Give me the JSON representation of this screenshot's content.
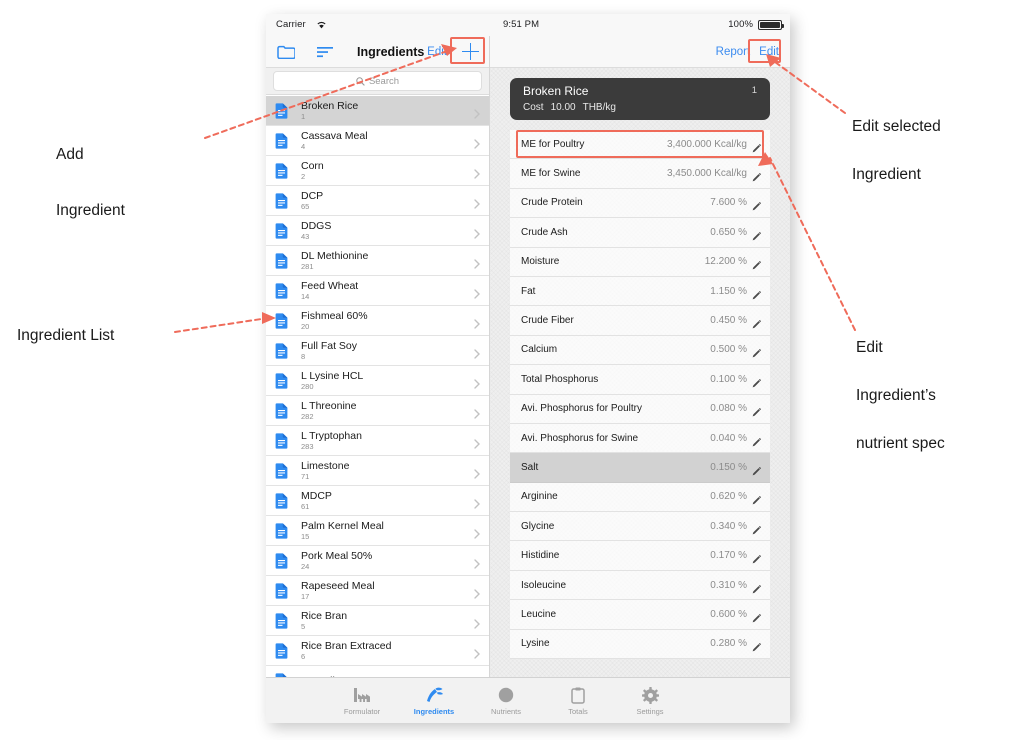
{
  "status_left": {
    "carrier": "Carrier",
    "wifi_icon": "wifi-icon"
  },
  "status_right": {
    "time": "9:51 PM",
    "battery_percent": "100%",
    "battery_icon": "battery-full-icon"
  },
  "master": {
    "title": "Ingredients",
    "edit_label": "Edit",
    "folder_icon": "folder-icon",
    "sort_icon": "sort-icon",
    "add_icon": "plus-icon",
    "search_placeholder": "Search",
    "search_icon": "search-icon",
    "items": [
      {
        "name": "Broken Rice",
        "num": "1",
        "selected": true
      },
      {
        "name": "Cassava Meal",
        "num": "4",
        "selected": false
      },
      {
        "name": "Corn",
        "num": "2",
        "selected": false
      },
      {
        "name": "DCP",
        "num": "65",
        "selected": false
      },
      {
        "name": "DDGS",
        "num": "43",
        "selected": false
      },
      {
        "name": "DL Methionine",
        "num": "281",
        "selected": false
      },
      {
        "name": "Feed Wheat",
        "num": "14",
        "selected": false
      },
      {
        "name": "Fishmeal 60%",
        "num": "20",
        "selected": false
      },
      {
        "name": "Full Fat Soy",
        "num": "8",
        "selected": false
      },
      {
        "name": "L Lysine HCL",
        "num": "280",
        "selected": false
      },
      {
        "name": "L Threonine",
        "num": "282",
        "selected": false
      },
      {
        "name": "L Tryptophan",
        "num": "283",
        "selected": false
      },
      {
        "name": "Limestone",
        "num": "71",
        "selected": false
      },
      {
        "name": "MDCP",
        "num": "61",
        "selected": false
      },
      {
        "name": "Palm Kernel Meal",
        "num": "15",
        "selected": false
      },
      {
        "name": "Pork Meal 50%",
        "num": "24",
        "selected": false
      },
      {
        "name": "Rapeseed Meal",
        "num": "17",
        "selected": false
      },
      {
        "name": "Rice Bran",
        "num": "5",
        "selected": false
      },
      {
        "name": "Rice Bran Extraced",
        "num": "6",
        "selected": false
      },
      {
        "name": "Soy Oil",
        "num": "",
        "selected": false
      }
    ]
  },
  "detail": {
    "report_label": "Report",
    "edit_label": "Edit",
    "card": {
      "title": "Broken Rice",
      "count": "1",
      "cost_label": "Cost",
      "cost_value": "10.00",
      "cost_unit": "THB/kg"
    },
    "edit_icon": "pencil-icon",
    "nutrients": [
      {
        "label": "ME for Poultry",
        "value": "3,400.000 Kcal/kg",
        "highlight": false
      },
      {
        "label": "ME for Swine",
        "value": "3,450.000 Kcal/kg",
        "highlight": false
      },
      {
        "label": "Crude Protein",
        "value": "7.600 %",
        "highlight": false
      },
      {
        "label": "Crude Ash",
        "value": "0.650 %",
        "highlight": false
      },
      {
        "label": "Moisture",
        "value": "12.200 %",
        "highlight": false
      },
      {
        "label": "Fat",
        "value": "1.150 %",
        "highlight": false
      },
      {
        "label": "Crude Fiber",
        "value": "0.450 %",
        "highlight": false
      },
      {
        "label": "Calcium",
        "value": "0.500 %",
        "highlight": false
      },
      {
        "label": "Total Phosphorus",
        "value": "0.100 %",
        "highlight": false
      },
      {
        "label": "Avi. Phosphorus for Poultry",
        "value": "0.080 %",
        "highlight": false
      },
      {
        "label": "Avi. Phosphorus for Swine",
        "value": "0.040 %",
        "highlight": false
      },
      {
        "label": "Salt",
        "value": "0.150 %",
        "highlight": true
      },
      {
        "label": "Arginine",
        "value": "0.620 %",
        "highlight": false
      },
      {
        "label": "Glycine",
        "value": "0.340 %",
        "highlight": false
      },
      {
        "label": "Histidine",
        "value": "0.170 %",
        "highlight": false
      },
      {
        "label": "Isoleucine",
        "value": "0.310 %",
        "highlight": false
      },
      {
        "label": "Leucine",
        "value": "0.600 %",
        "highlight": false
      },
      {
        "label": "Lysine",
        "value": "0.280 %",
        "highlight": false
      }
    ]
  },
  "tabbar": {
    "tabs": [
      {
        "label": "Formulator",
        "icon": "factory-icon",
        "active": false
      },
      {
        "label": "Ingredients",
        "icon": "ingredients-icon",
        "active": true
      },
      {
        "label": "Nutrients",
        "icon": "circle-icon",
        "active": false
      },
      {
        "label": "Totals",
        "icon": "clipboard-icon",
        "active": false
      },
      {
        "label": "Settings",
        "icon": "gear-icon",
        "active": false
      }
    ]
  },
  "annotations": {
    "add_ingredient": "Add\nIngredient",
    "add_ingredient_line1": "Add",
    "add_ingredient_line2": "Ingredient",
    "ingredient_list": "Ingredient List",
    "edit_selected_line1": "Edit selected",
    "edit_selected_line2": "Ingredient",
    "edit_nutrient_line1": "Edit",
    "edit_nutrient_line2": "Ingredient’s",
    "edit_nutrient_line3": "nutrient spec",
    "accent_color": "#ef6b5a"
  }
}
